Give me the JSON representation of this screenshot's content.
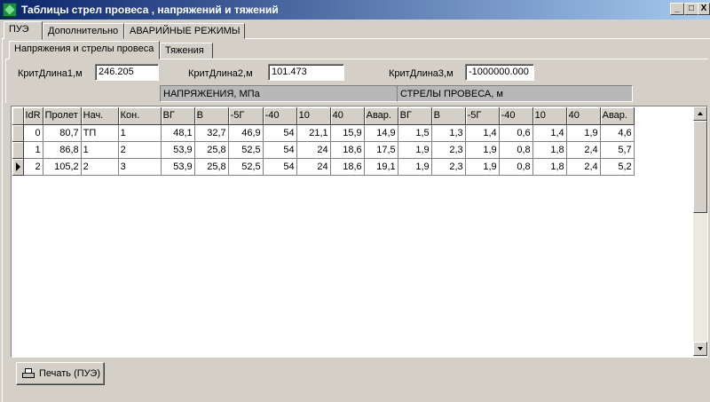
{
  "window": {
    "title": "Таблицы стрел провеса , напряжений и тяжений",
    "minimize": "_",
    "maximize": "□",
    "close": "X"
  },
  "tabs_main": [
    "ПУЭ",
    "Дополнительно",
    "АВАРИЙНЫЕ РЕЖИМЫ"
  ],
  "tabs_sub": [
    "Напряжения и стрелы провеса",
    "Тяжения"
  ],
  "crit": {
    "l1_label": "КритДлина1,м",
    "l1_value": "246.205",
    "l2_label": "КритДлина2,м",
    "l2_value": "101.473",
    "l3_label": "КритДлина3,м",
    "l3_value": "-1000000.000"
  },
  "groups": {
    "stress": "НАПРЯЖЕНИЯ, МПа",
    "sag": "СТРЕЛЫ ПРОВЕСА, м"
  },
  "grid": {
    "columns": [
      "IdR",
      "Пролет",
      "Нач.",
      "Кон.",
      "ВГ",
      "В",
      "-5Г",
      "-40",
      "10",
      "40",
      "Авар.",
      "ВГ",
      "В",
      "-5Г",
      "-40",
      "10",
      "40",
      "Авар."
    ],
    "rows": [
      [
        "0",
        "80,7",
        "ТП",
        "1",
        "48,1",
        "32,7",
        "46,9",
        "54",
        "21,1",
        "15,9",
        "14,9",
        "1,5",
        "1,3",
        "1,4",
        "0,6",
        "1,4",
        "1,9",
        "4,6"
      ],
      [
        "1",
        "86,8",
        "1",
        "2",
        "53,9",
        "25,8",
        "52,5",
        "54",
        "24",
        "18,6",
        "17,5",
        "1,9",
        "2,3",
        "1,9",
        "0,8",
        "1,8",
        "2,4",
        "5,7"
      ],
      [
        "2",
        "105,2",
        "2",
        "3",
        "53,9",
        "25,8",
        "52,5",
        "54",
        "24",
        "18,6",
        "19,1",
        "1,9",
        "2,3",
        "1,9",
        "0,8",
        "1,8",
        "2,4",
        "5,2"
      ]
    ],
    "current_row": 2
  },
  "print_button": "Печать (ПУЭ)",
  "icons": {
    "app": "app-icon",
    "printer": "printer-icon",
    "row_pointer": "row-pointer-icon"
  }
}
